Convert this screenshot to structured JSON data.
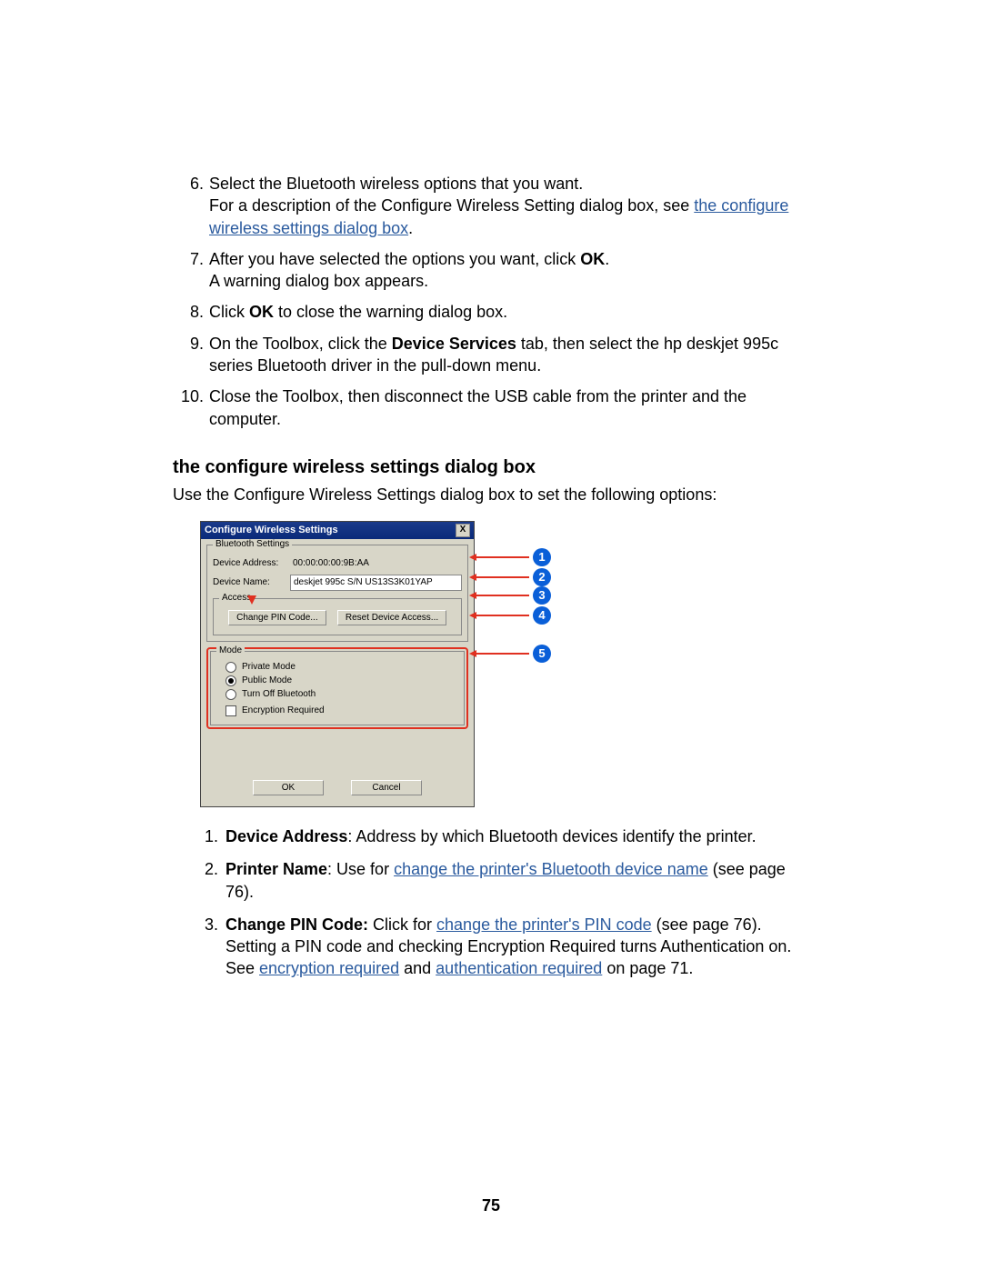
{
  "steps": [
    {
      "n": "6.",
      "plain1": "Select the Bluetooth wireless options that you want.",
      "plain2a": "For a description of the Configure Wireless Setting dialog box, see ",
      "link2": "the configure wireless settings dialog box",
      "plain2b": "."
    },
    {
      "n": "7.",
      "plain1a": "After you have selected the options you want, click ",
      "bold1": "OK",
      "plain1b": ".",
      "plain2": "A warning dialog box appears."
    },
    {
      "n": "8.",
      "plain1a": "Click ",
      "bold1": "OK",
      "plain1b": " to close the warning dialog box."
    },
    {
      "n": "9.",
      "plain1a": "On the Toolbox, click the ",
      "bold1": "Device Services",
      "plain1b": " tab, then select the hp deskjet 995c series Bluetooth driver in the pull-down menu."
    },
    {
      "n": "10.",
      "plain1": "Close the Toolbox, then disconnect the USB cable from the printer and the computer."
    }
  ],
  "section_title": "the configure wireless settings dialog box",
  "intro": "Use the Configure Wireless Settings dialog box to set the following options:",
  "dialog": {
    "title": "Configure Wireless Settings",
    "close": "X",
    "bt_legend": "Bluetooth Settings",
    "addr_label": "Device Address:",
    "addr_value": "00:00:00:00:9B:AA",
    "name_label": "Device Name:",
    "name_value": "deskjet 995c S/N US13S3K01YAP",
    "access_legend": "Access",
    "btn_pin": "Change PIN Code...",
    "btn_reset": "Reset Device Access...",
    "mode_legend": "Mode",
    "mode_private": "Private Mode",
    "mode_public": "Public Mode",
    "mode_off": "Turn Off Bluetooth",
    "mode_enc": "Encryption Required",
    "ok": "OK",
    "cancel": "Cancel"
  },
  "callouts": {
    "c1": "1",
    "c2": "2",
    "c3": "3",
    "c4": "4",
    "c5": "5"
  },
  "desc": [
    {
      "n": "1.",
      "bold": "Device Address",
      "after_bold": ": Address by which Bluetooth devices identify the printer."
    },
    {
      "n": "2.",
      "bold": "Printer Name",
      "after_bold": ": Use for ",
      "link1": "change the printer's Bluetooth device name",
      "tail": " (see page 76)."
    },
    {
      "n": "3.",
      "bold": "Change PIN Code:",
      "after_bold": " Click for ",
      "link1": "change the printer's PIN code",
      "mid": " (see page 76). Setting a PIN code and checking Encryption Required turns Authentication on. See ",
      "link2": "encryption required",
      "mid2": " and ",
      "link3": "authentication required",
      "tail": " on page 71."
    }
  ],
  "page_number": "75"
}
